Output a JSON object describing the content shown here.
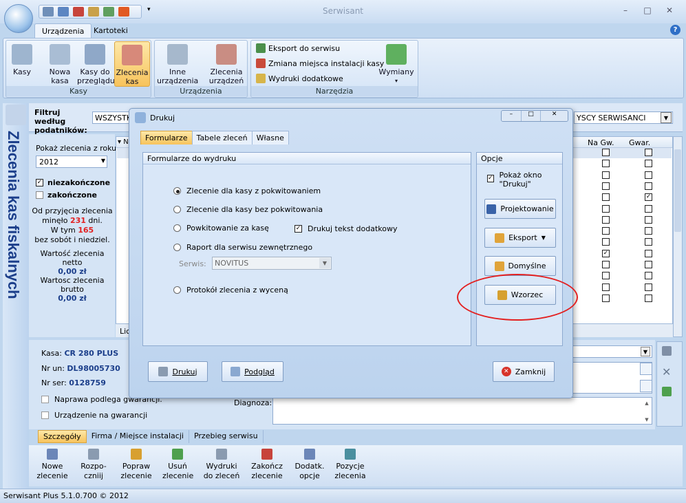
{
  "window": {
    "title": "Serwisant",
    "min": "–",
    "max": "□",
    "close": "✕"
  },
  "tabs": [
    {
      "label": "Urządzenia"
    },
    {
      "label": "Kartoteki"
    }
  ],
  "help": "?",
  "ribbon": {
    "groups": [
      {
        "label": "Kasy"
      },
      {
        "label": "Urządzenia"
      },
      {
        "label": "Narzędzia"
      }
    ],
    "kasy": [
      "Kasy",
      "Nowa\nkasa",
      "Kasy do\nprzeglądu",
      "Zlecenia\nkas"
    ],
    "urz": [
      "Inne\nurządzenia",
      "Zlecenia\nurządzeń"
    ],
    "tools": [
      "Eksport do serwisu",
      "Zmiana miejsca instalacji kasy",
      "Wydruki dodatkowe"
    ],
    "wymiany": "Wymiany"
  },
  "sidebar": {
    "title": "Zlecenia kas fiskalnych"
  },
  "filter": {
    "label": "Filtruj według podatników:",
    "value": "WSZYSTKIE",
    "right_value": "YSCY SERWISANCI"
  },
  "left": {
    "year_label": "Pokaż zlecenia z roku:",
    "year": "2012",
    "niezak": "niezakończone",
    "zak": "zakończone",
    "l1": "Od przyjęcia zlecenia",
    "l2a": "minęło ",
    "days": "231",
    "l2b": " dni.",
    "l3a": "W tym ",
    "days2": "165",
    "l4": "bez sobót i niedziel.",
    "netto_label": "Wartość zlecenia netto",
    "netto": "0,00 zł",
    "brutto_label": "Wartosc zlecenia brutto",
    "brutto": "0,00 zł"
  },
  "grid": {
    "col_n": "N",
    "col_nagw": "Na Gw.",
    "col_gwar": "Gwar.",
    "footer": "Lic",
    "nagw": [
      false,
      false,
      false,
      false,
      false,
      false,
      false,
      false,
      false,
      true,
      false,
      false,
      false,
      false
    ],
    "gwar": [
      false,
      false,
      false,
      false,
      true,
      false,
      false,
      false,
      false,
      false,
      false,
      false,
      false,
      false
    ]
  },
  "details": {
    "kasa_label": "Kasa:",
    "kasa": "CR 280 PLUS",
    "nrun_label": "Nr un:",
    "nrun": "DL98005730",
    "nrser_label": "Nr ser:",
    "nrser": "0128759",
    "naprawa": "Naprawa podlega gwarancji.",
    "nagw": "Urządzenie na gwarancji",
    "diagnoza": "Diagnoza:"
  },
  "bottomtabs": [
    "Szczegóły",
    "Firma / Miejsce instalacji",
    "Przebieg serwisu"
  ],
  "bottom": [
    "Nowe\nzlecenie",
    "Rozpo-\nczniij",
    "Popraw\nzlecenie",
    "Usuń\nzlecenie",
    "Wydruki\ndo zleceń",
    "Zakończ\nzlecenie",
    "Dodatk.\nopcje",
    "Pozycje\nzlecenia"
  ],
  "status": "Serwisant Plus 5.1.0.700 © 2012",
  "dialog": {
    "title": "Drukuj",
    "tabs": [
      "Formularze",
      "Tabele zleceń",
      "Własne"
    ],
    "forms_header": "Formularze do wydruku",
    "options_header": "Opcje",
    "opt1": "Zlecenie dla kasy z pokwitowaniem",
    "opt2": "Zlecenie dla kasy bez pokwitowania",
    "opt3": "Powkitowanie za kasę",
    "extra": "Drukuj tekst dodatkowy",
    "opt4": "Raport dla serwisu zewnętrznego",
    "serwis_label": "Serwis:",
    "serwis": "NOVITUS",
    "opt5": "Protokół zlecenia z wyceną",
    "pokaz": "Pokaż okno \"Drukuj\"",
    "b_proj": "Projektowanie",
    "b_eksport": "Eksport",
    "b_dom": "Domyślne",
    "b_wzorzec": "Wzorzec",
    "b_drukuj": "Drukuj",
    "b_podglad": "Podgląd",
    "b_zamknij": "Zamknij"
  },
  "colors": {
    "accent": "#1b3e8a",
    "red": "#e32020",
    "highlight": "#f7c35c"
  }
}
